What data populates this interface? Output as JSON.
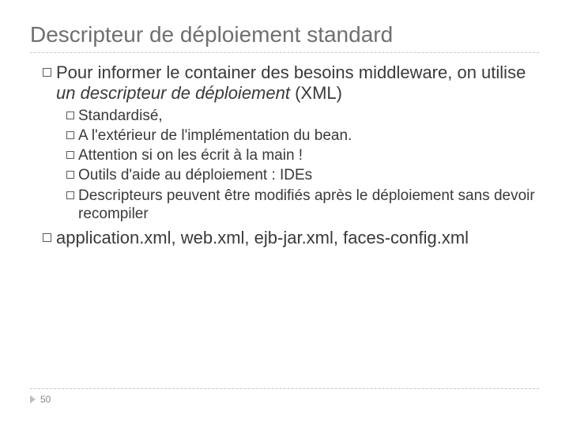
{
  "title": "Descripteur de déploiement standard",
  "l1a_prefix": "Pour informer le container des besoins middleware, on utilise ",
  "l1a_italic": "un descripteur de déploiement",
  "l1a_suffix": " (XML)",
  "sub": {
    "s1": "Standardisé,",
    "s2": "A l'extérieur de l'implémentation du bean.",
    "s3": "Attention si on les écrit à la main !",
    "s4": "Outils d'aide au déploiement : IDEs",
    "s5": "Descripteurs peuvent être modifiés après le déploiement sans devoir recompiler"
  },
  "l1b": "application.xml, web.xml, ejb-jar.xml, faces-config.xml",
  "page_number": "50"
}
